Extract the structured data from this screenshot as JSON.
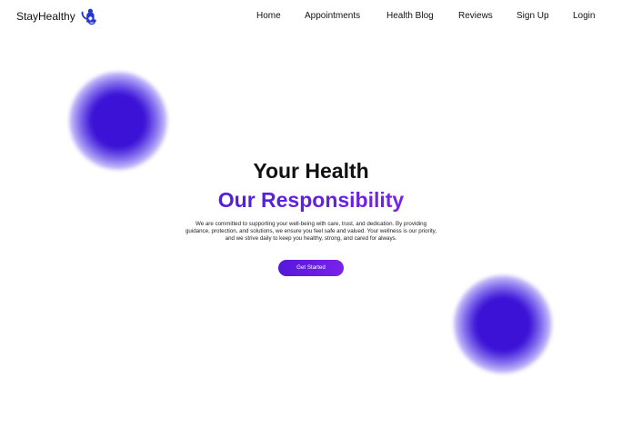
{
  "site": {
    "brand_name": "StayHealthy",
    "brand_icon": "doctor-stethoscope-icon"
  },
  "nav": {
    "items": [
      {
        "label": "Home"
      },
      {
        "label": "Appointments"
      },
      {
        "label": "Health Blog"
      },
      {
        "label": "Reviews"
      },
      {
        "label": "Sign Up"
      },
      {
        "label": "Login"
      }
    ]
  },
  "hero": {
    "title_line_1": "Your Health",
    "title_line_2": "Our Responsibility",
    "description": "We are committed to supporting your well-being with care, trust, and dedication. By providing guidance, protection, and solutions, we ensure you feel safe and valued. Your wellness is our priority, and we strive daily to keep you healthy, strong, and cared for always.",
    "cta_label": "Get Started"
  },
  "colors": {
    "accent_blue": "#3b12d6",
    "accent_purple": "#7a22ea",
    "gradient_text_start": "#2d12d7",
    "gradient_text_end": "#9b2cf3",
    "text": "#111111",
    "background": "#ffffff"
  }
}
